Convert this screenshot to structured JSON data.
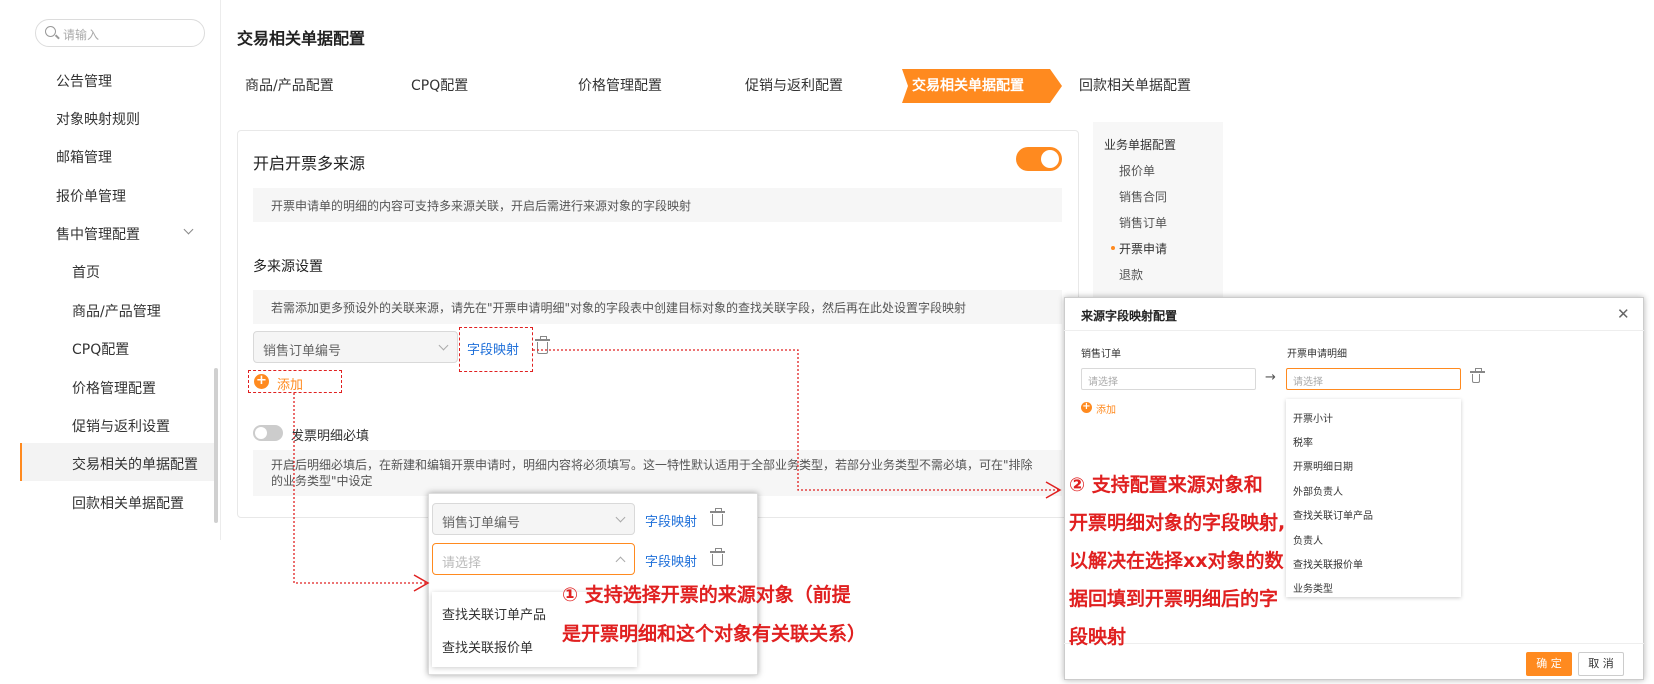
{
  "search": {
    "placeholder": "请输入"
  },
  "sidebar": {
    "items": [
      "公告管理",
      "对象映射规则",
      "邮箱管理",
      "报价单管理",
      "售中管理配置"
    ],
    "sub_items": [
      "首页",
      "商品/产品管理",
      "CPQ配置",
      "价格管理配置",
      "促销与返利设置",
      "交易相关的单据配置",
      "回款相关单据配置"
    ],
    "active": "交易相关的单据配置"
  },
  "page_title": "交易相关单据配置",
  "steps": [
    "商品/产品配置",
    "CPQ配置",
    "价格管理配置",
    "促销与返利配置",
    "交易相关单据配置",
    "回款相关单据配置"
  ],
  "active_step": "交易相关单据配置",
  "main": {
    "multi_source_title": "开启开票多来源",
    "multi_source_on": true,
    "multi_source_desc": "开票申请单的明细的内容可支持多来源关联，开启后需进行来源对象的字段映射",
    "settings_title": "多来源设置",
    "settings_hint": "若需添加更多预设外的关联来源，请先在\"开票申请明细\"对象的字段表中创建目标对象的查找关联字段，然后再在此处设置字段映射",
    "source_select_value": "销售订单编号",
    "field_mapping_link": "字段映射",
    "add_label": "添加",
    "required_label": "发票明细必填",
    "required_on": false,
    "required_desc_line1": "开启后明细必填后，在新建和编辑开票申请时，明细内容将必须填写。这一特性默认适用于全部业务类型，若部分业务类型不需必填，可在\"排除",
    "required_desc_line2": "的业务类型\"中设定"
  },
  "right_nav": {
    "group": "业务单据配置",
    "items": [
      "报价单",
      "销售合同",
      "销售订单",
      "开票申请",
      "退款"
    ],
    "active": "开票申请"
  },
  "popup": {
    "row1_value": "销售订单编号",
    "row2_placeholder": "请选择",
    "link": "字段映射",
    "options": [
      "查找关联订单产品",
      "查找关联报价单"
    ]
  },
  "callout1": {
    "line1": "① 支持选择开票的来源对象（前提",
    "line2": "是开票明细和这个对象有关联关系）"
  },
  "callout2": {
    "lines": [
      "② 支持配置来源对象和",
      "开票明细对象的字段映射,",
      "以解决在选择xx对象的数",
      "据回填到开票明细后的字",
      "段映射"
    ]
  },
  "dialog": {
    "title": "来源字段映射配置",
    "col_source": "销售订单",
    "col_target": "开票申请明细",
    "placeholder": "请选择",
    "add_label": "添加",
    "options": [
      "开票小计",
      "税率",
      "开票明细日期",
      "外部负责人",
      "查找关联订单产品",
      "负责人",
      "查找关联报价单",
      "业务类型"
    ],
    "ok": "确 定",
    "cancel": "取 消"
  },
  "colors": {
    "accent": "#ff8a1f",
    "link": "#1e6fd9",
    "annotation": "#e02020"
  }
}
